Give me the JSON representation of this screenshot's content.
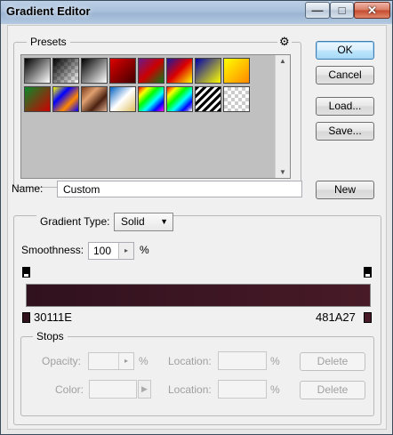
{
  "window": {
    "title": "Gradient Editor",
    "controls": {
      "minimize_glyph": "—",
      "maximize_glyph": "□",
      "close_glyph": "✕"
    }
  },
  "presets": {
    "label": "Presets",
    "menu_icon": "gear-icon",
    "swatches": [
      "linear-gradient(135deg,#000,#fff)",
      "checker-black",
      "linear-gradient(135deg,#000,#fff)",
      "linear-gradient(135deg,#d00,#400)",
      "linear-gradient(135deg,#6a1a8a,#c00,#0a7a1a)",
      "linear-gradient(135deg,#1a1aa0,#d00,#ff0)",
      "linear-gradient(135deg,#00a,#ff0)",
      "linear-gradient(135deg,#ff0,#f80)",
      "linear-gradient(135deg,#0a8a2a,#c00)",
      "linear-gradient(135deg,#ff0,#00f,#f80,#00f)",
      "linear-gradient(135deg,#7a3a1a,#e0a070,#4a2010,#e0b090)",
      "linear-gradient(135deg,#0060c0,#fff,#e0c060)",
      "linear-gradient(135deg,#f00,#ff0,#0f0,#0ff,#00f,#f0f)",
      "checker-rainbow",
      "stripes",
      "checker"
    ]
  },
  "buttons": {
    "ok": "OK",
    "cancel": "Cancel",
    "load": "Load...",
    "save": "Save...",
    "new": "New"
  },
  "name": {
    "label": "Name:",
    "value": "Custom"
  },
  "gradient_type": {
    "label": "Gradient Type:",
    "value": "Solid"
  },
  "smoothness": {
    "label": "Smoothness:",
    "value": "100",
    "unit": "%"
  },
  "gradient": {
    "start_color": "#30111E",
    "end_color": "#481A27",
    "start_label": "30111E",
    "end_label": "481A27"
  },
  "stops": {
    "label": "Stops",
    "opacity_label": "Opacity:",
    "opacity_unit": "%",
    "location_label": "Location:",
    "location_unit": "%",
    "delete_label": "Delete",
    "color_label": "Color:"
  }
}
